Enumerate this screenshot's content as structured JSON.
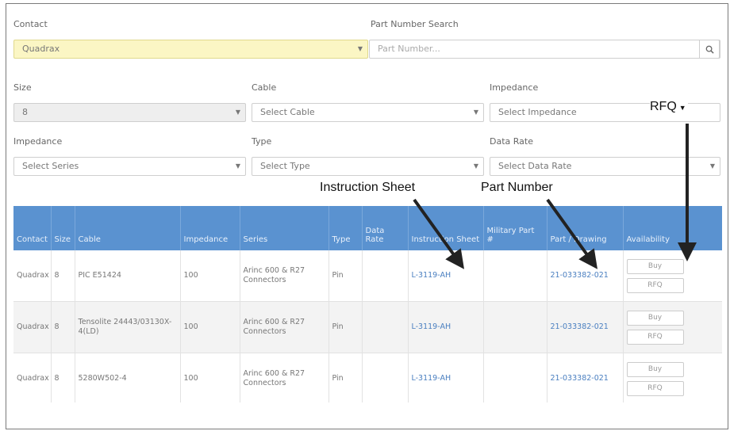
{
  "filters": {
    "contact": {
      "label": "Contact",
      "value": "Quadrax"
    },
    "part_search": {
      "label": "Part Number Search",
      "placeholder": "Part Number..."
    },
    "size": {
      "label": "Size",
      "value": "8"
    },
    "cable": {
      "label": "Cable",
      "value": "Select Cable"
    },
    "impedance_top": {
      "label": "Impedance",
      "value": "Select Impedance"
    },
    "impedance_series": {
      "label": "Impedance",
      "value": "Select Series"
    },
    "type": {
      "label": "Type",
      "value": "Select Type"
    },
    "data_rate": {
      "label": "Data Rate",
      "value": "Select Data Rate"
    }
  },
  "annotations": {
    "rfq": "RFQ",
    "instruction_sheet": "Instruction Sheet",
    "part_number": "Part Number"
  },
  "table": {
    "headers": [
      "Contact",
      "Size",
      "Cable",
      "Impedance",
      "Series",
      "Type",
      "Data Rate",
      "Instruction Sheet",
      "Military Part #",
      "Part / Drawing",
      "Availability"
    ],
    "rows": [
      {
        "contact": "Quadrax",
        "size": "8",
        "cable": "PIC E51424",
        "impedance": "100",
        "series": "Arinc 600 & R27 Connectors",
        "type": "Pin",
        "data_rate": "",
        "instruction": "L-3119-AH",
        "military": "",
        "part": "21-033382-021",
        "buy": "Buy",
        "rfq": "RFQ"
      },
      {
        "contact": "Quadrax",
        "size": "8",
        "cable": "Tensolite 24443/03130X-4(LD)",
        "impedance": "100",
        "series": "Arinc 600 & R27 Connectors",
        "type": "Pin",
        "data_rate": "",
        "instruction": "L-3119-AH",
        "military": "",
        "part": "21-033382-021",
        "buy": "Buy",
        "rfq": "RFQ"
      },
      {
        "contact": "Quadrax",
        "size": "8",
        "cable": "5280W502-4",
        "impedance": "100",
        "series": "Arinc 600 & R27 Connectors",
        "type": "Pin",
        "data_rate": "",
        "instruction": "L-3119-AH",
        "military": "",
        "part": "21-033382-021",
        "buy": "Buy",
        "rfq": "RFQ"
      }
    ]
  },
  "colors": {
    "header_bg": "#5a92d0",
    "link": "#4a7fc0",
    "contact_bg": "#fbf6c4"
  }
}
